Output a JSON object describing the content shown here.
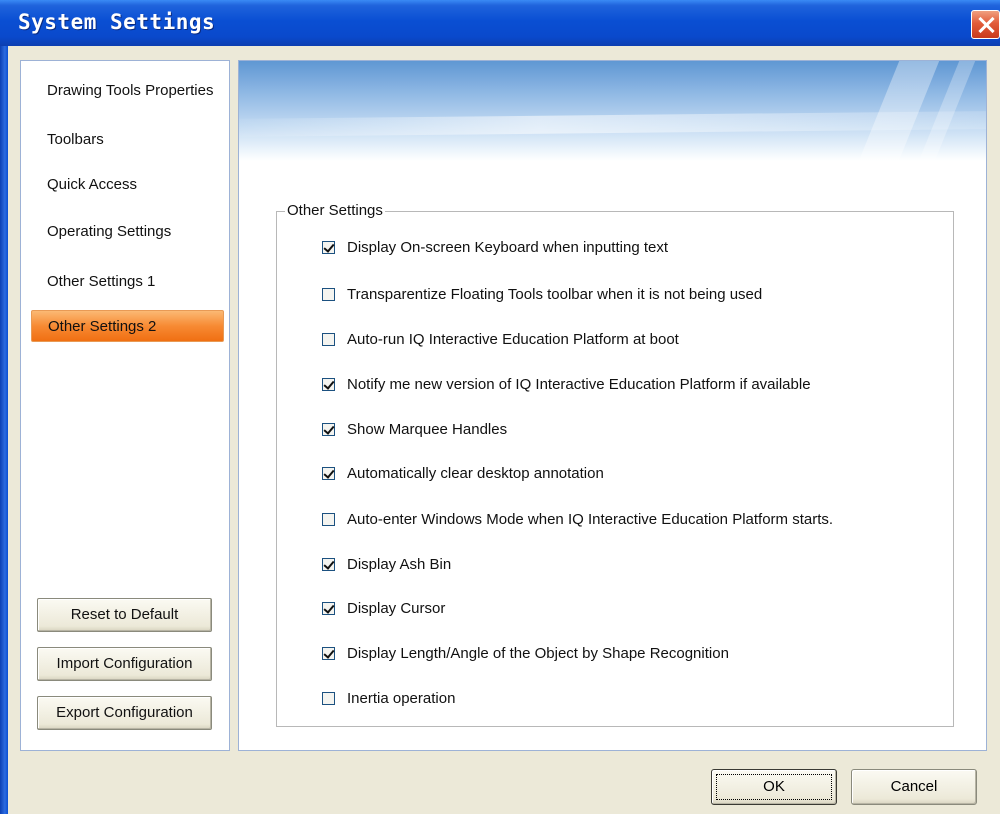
{
  "window": {
    "title": "System Settings"
  },
  "sidebar": {
    "items": [
      {
        "label": "Drawing Tools Properties",
        "active": false
      },
      {
        "label": "Toolbars",
        "active": false
      },
      {
        "label": "Quick Access",
        "active": false
      },
      {
        "label": "Operating Settings",
        "active": false
      },
      {
        "label": "Other Settings 1",
        "active": false
      },
      {
        "label": "Other Settings 2",
        "active": true
      }
    ],
    "buttons": {
      "reset": "Reset to Default",
      "import": "Import Configuration",
      "export": "Export Configuration"
    }
  },
  "content": {
    "group_title": "Other Settings",
    "options": [
      {
        "label": "Display On-screen Keyboard when inputting text",
        "checked": true
      },
      {
        "label": "Transparentize Floating Tools toolbar when it is not being used",
        "checked": false
      },
      {
        "label": "Auto-run IQ Interactive Education Platform at boot",
        "checked": false
      },
      {
        "label": "Notify me new version of IQ Interactive Education Platform if available",
        "checked": true
      },
      {
        "label": "Show Marquee Handles",
        "checked": true
      },
      {
        "label": "Automatically clear desktop annotation",
        "checked": true
      },
      {
        "label": "Auto-enter Windows Mode when IQ Interactive Education Platform starts.",
        "checked": false
      },
      {
        "label": "Display Ash Bin",
        "checked": true
      },
      {
        "label": "Display Cursor",
        "checked": true
      },
      {
        "label": "Display Length/Angle of the Object by Shape Recognition",
        "checked": true
      },
      {
        "label": "Inertia operation",
        "checked": false
      }
    ]
  },
  "footer": {
    "ok": "OK",
    "cancel": "Cancel"
  },
  "colors": {
    "title_bar": "#0a4fd3",
    "active_nav": "#f78a33",
    "close_button": "#e25c3a"
  }
}
